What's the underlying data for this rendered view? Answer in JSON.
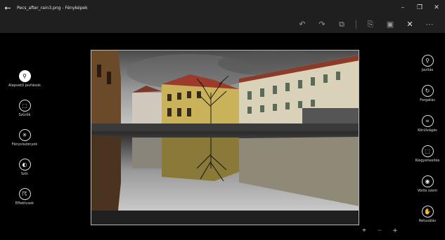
{
  "window": {
    "title": "Pecs_after_rain3.png - Fényképek",
    "back_glyph": "←",
    "controls": [
      "–",
      "❐",
      "✕"
    ]
  },
  "toolbar": {
    "icons": [
      "undo-icon",
      "redo-icon",
      "compare-icon",
      "save-copy-icon",
      "save-icon",
      "close-icon",
      "more-icon"
    ],
    "glyphs": {
      "undo": "↶",
      "redo": "↷",
      "compare": "⧉",
      "save_copy": "⎘",
      "save": "▣",
      "close": "✕",
      "more": "⋯"
    }
  },
  "left_tools": [
    {
      "label": "Alapvető javítások",
      "icon": "wand-icon",
      "glyph": "⚲"
    },
    {
      "label": "Szűrők",
      "icon": "filter-icon",
      "glyph": "⬚"
    },
    {
      "label": "Fényviszonyok",
      "icon": "light-icon",
      "glyph": "✳"
    },
    {
      "label": "Szín",
      "icon": "palette-icon",
      "glyph": "◐"
    },
    {
      "label": "Effektusok",
      "icon": "effects-icon",
      "glyph": "☈"
    }
  ],
  "right_tools": [
    {
      "label": "Javítás",
      "icon": "enhance-icon",
      "glyph": "⚲"
    },
    {
      "label": "Forgatás",
      "icon": "rotate-icon",
      "glyph": "↻"
    },
    {
      "label": "Körülvágás",
      "icon": "crop-icon",
      "glyph": "⌗"
    },
    {
      "label": "Kiegyenesítés",
      "icon": "straighten-icon",
      "glyph": "⬚"
    },
    {
      "label": "Vörös szem",
      "icon": "red-eye-icon",
      "glyph": "◉"
    },
    {
      "label": "Retusálás",
      "icon": "retouch-icon",
      "glyph": "✋"
    }
  ],
  "zoom": {
    "fit_glyph": "⌖",
    "minus_glyph": "−",
    "plus_glyph": "+"
  },
  "colors": {
    "chrome": "#1f1f1f",
    "canvas": "#000000",
    "text": "#ffffff"
  }
}
